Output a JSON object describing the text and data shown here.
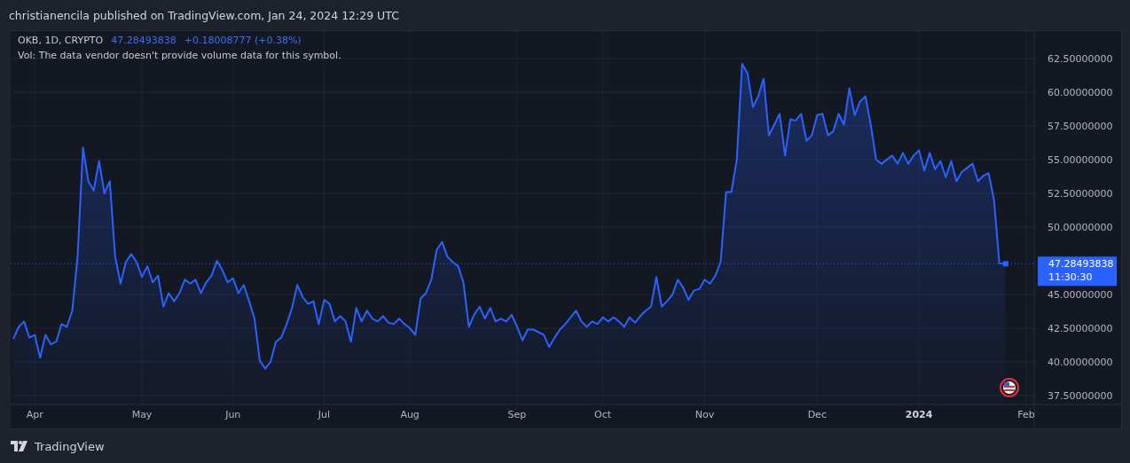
{
  "header": {
    "text": "christianencila published on TradingView.com, Jan 24, 2024 12:29 UTC"
  },
  "legend": {
    "symbol": "OKB, 1D, CRYPTO",
    "price": "47.28493838",
    "change": "+0.18008777 (+0.38%)",
    "volume_note": "Vol: The data vendor doesn't provide volume data for this symbol."
  },
  "chart": {
    "chart_data": {
      "type": "area",
      "grid": true,
      "ylim": [
        36.84,
        64.54
      ],
      "ref_lines": [
        {
          "axis": "y",
          "value": 47.28,
          "color": "#2962ff"
        }
      ],
      "categories": [
        null,
        null,
        null,
        null,
        "Apr",
        null,
        null,
        null,
        null,
        null,
        null,
        null,
        null,
        null,
        null,
        null,
        null,
        null,
        null,
        null,
        null,
        null,
        null,
        null,
        "May",
        null,
        null,
        null,
        null,
        null,
        null,
        null,
        null,
        null,
        null,
        null,
        null,
        null,
        null,
        null,
        null,
        "Jun",
        null,
        null,
        null,
        null,
        null,
        null,
        null,
        null,
        null,
        null,
        null,
        null,
        null,
        null,
        null,
        null,
        "Jul",
        null,
        null,
        null,
        null,
        null,
        null,
        null,
        null,
        null,
        null,
        null,
        null,
        null,
        null,
        null,
        "Aug",
        null,
        null,
        null,
        null,
        null,
        null,
        null,
        null,
        null,
        null,
        null,
        null,
        null,
        null,
        null,
        null,
        null,
        null,
        null,
        "Sep",
        null,
        null,
        null,
        null,
        null,
        null,
        null,
        null,
        null,
        null,
        null,
        null,
        null,
        null,
        null,
        "Oct",
        null,
        null,
        null,
        null,
        null,
        null,
        null,
        null,
        null,
        null,
        null,
        null,
        null,
        null,
        null,
        null,
        null,
        null,
        "Nov",
        null,
        null,
        null,
        null,
        null,
        null,
        null,
        null,
        null,
        null,
        null,
        null,
        null,
        null,
        null,
        null,
        null,
        null,
        null,
        null,
        "Dec",
        null,
        null,
        null,
        null,
        null,
        null,
        null,
        null,
        null,
        null,
        null,
        null,
        null,
        null,
        null,
        null,
        null,
        null,
        "2024",
        null,
        null,
        null,
        null,
        null,
        null,
        null,
        null,
        null,
        null,
        null,
        null,
        null,
        null,
        null,
        null,
        null,
        null,
        null,
        "Feb",
        null
      ],
      "series": [
        {
          "color": "#2962ff",
          "values": [
            41.7,
            42.6,
            43.0,
            41.8,
            42.0,
            40.3,
            42.0,
            41.3,
            41.5,
            42.8,
            42.6,
            43.8,
            47.8,
            55.9,
            53.4,
            52.7,
            54.9,
            52.5,
            53.4,
            47.8,
            45.8,
            47.4,
            48.0,
            47.4,
            46.3,
            47.1,
            45.9,
            46.4,
            44.1,
            45.1,
            44.5,
            45.1,
            46.1,
            45.8,
            46.1,
            45.1,
            45.9,
            46.4,
            47.5,
            46.8,
            45.9,
            46.2,
            45.1,
            45.7,
            44.5,
            43.2,
            40.1,
            39.5,
            40.0,
            41.5,
            41.8,
            42.8,
            44.0,
            45.7,
            44.8,
            44.3,
            44.5,
            42.8,
            44.6,
            44.3,
            43.0,
            43.4,
            43.0,
            41.5,
            44.0,
            43.0,
            43.8,
            43.2,
            43.0,
            43.4,
            42.9,
            42.8,
            43.2,
            42.8,
            42.5,
            42.0,
            44.7,
            45.1,
            46.1,
            48.3,
            48.9,
            47.8,
            47.4,
            47.1,
            45.9,
            42.6,
            43.5,
            44.1,
            43.2,
            44.0,
            43.0,
            43.2,
            43.0,
            43.5,
            42.6,
            41.6,
            42.4,
            42.4,
            42.2,
            42.0,
            41.1,
            41.8,
            42.4,
            42.8,
            43.3,
            43.8,
            43.0,
            42.6,
            43.0,
            42.8,
            43.3,
            43.0,
            43.3,
            43.0,
            42.6,
            43.3,
            42.9,
            43.4,
            43.8,
            44.1,
            46.3,
            44.1,
            44.5,
            45.0,
            46.1,
            45.5,
            44.6,
            45.3,
            45.4,
            46.1,
            45.8,
            46.4,
            47.4,
            52.6,
            52.6,
            55.0,
            62.1,
            61.4,
            58.9,
            59.7,
            61.0,
            56.8,
            57.6,
            58.4,
            55.3,
            58.0,
            57.9,
            58.4,
            56.4,
            56.8,
            58.3,
            58.4,
            56.8,
            57.1,
            58.4,
            57.6,
            60.3,
            58.3,
            59.3,
            59.7,
            57.6,
            55.0,
            54.7,
            55.0,
            55.3,
            54.7,
            55.5,
            54.7,
            55.3,
            55.7,
            54.2,
            55.5,
            54.3,
            54.9,
            53.7,
            54.9,
            53.4,
            54.1,
            54.4,
            54.7,
            53.4,
            53.8,
            54.0,
            52.0,
            47.3,
            47.28,
            null,
            null,
            null,
            null,
            null
          ]
        }
      ],
      "yticks": [
        {
          "value": 37.5,
          "label": "37.50000000"
        },
        {
          "value": 40,
          "label": "40.00000000"
        },
        {
          "value": 42.5,
          "label": "42.50000000"
        },
        {
          "value": 45,
          "label": "45.00000000"
        },
        {
          "value": 50,
          "label": "50.00000000"
        },
        {
          "value": 52.5,
          "label": "52.50000000"
        },
        {
          "value": 55,
          "label": "55.00000000"
        },
        {
          "value": 57.5,
          "label": "57.50000000"
        },
        {
          "value": 60,
          "label": "60.00000000"
        },
        {
          "value": 62.5,
          "label": "62.50000000"
        }
      ]
    },
    "price_label": {
      "price": "47.28493838",
      "countdown": "11:30:30"
    }
  },
  "footer": {
    "brand": "TradingView"
  }
}
